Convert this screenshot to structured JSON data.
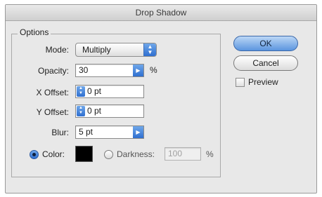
{
  "dialog": {
    "title": "Drop Shadow"
  },
  "options": {
    "legend": "Options",
    "mode": {
      "label": "Mode:",
      "value": "Multiply"
    },
    "opacity": {
      "label": "Opacity:",
      "value": "30",
      "unit": "%"
    },
    "x_offset": {
      "label": "X Offset:",
      "value": "0 pt"
    },
    "y_offset": {
      "label": "Y Offset:",
      "value": "0 pt"
    },
    "blur": {
      "label": "Blur:",
      "value": "5 pt"
    },
    "color": {
      "label": "Color:",
      "selected": true,
      "swatch": "#000000"
    },
    "darkness": {
      "label": "Darkness:",
      "value": "100",
      "unit": "%",
      "enabled": false
    }
  },
  "buttons": {
    "ok": "OK",
    "cancel": "Cancel"
  },
  "preview": {
    "label": "Preview",
    "checked": false
  },
  "colors": {
    "accent_blue": "#2f6fd0",
    "dialog_bg": "#e8e8e8"
  }
}
